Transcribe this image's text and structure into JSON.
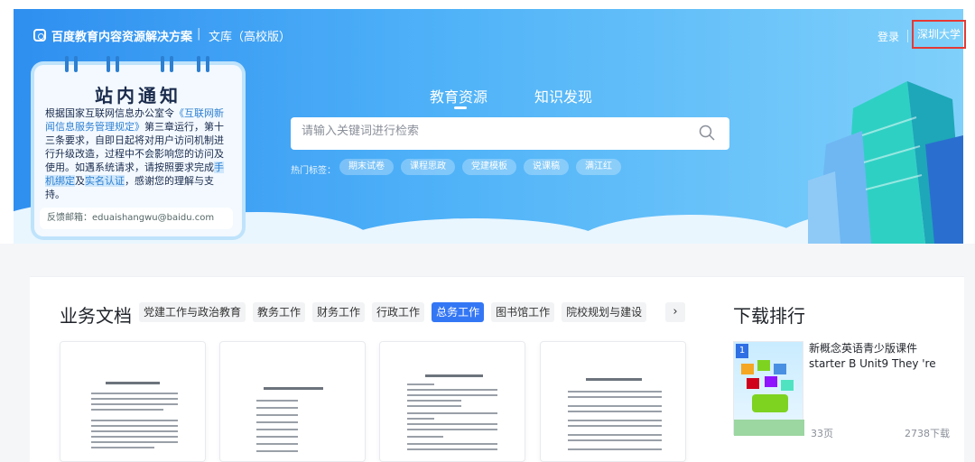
{
  "header": {
    "brand": "百度教育内容资源解决方案",
    "brand_separator": "|",
    "sub_brand": "文库（高校版）",
    "login_label": "登录",
    "org_name": "深圳大学"
  },
  "notice": {
    "title": "站内通知",
    "body_1": "根据国家互联网信息办公室令",
    "body_link_1": "《互联网新闻信息服务管理规定》",
    "body_2": "第三章运行，第十三条要求，自即日起将对用户访问机制进行升级改造，过程中不会影响您的访问及使用。如遇系统请求，请按照要求完成",
    "body_link_2": "手机绑定",
    "body_3": "及",
    "body_link_3": "实名认证",
    "body_4": "，感谢您的理解与支持。",
    "feedback_email": "反馈邮箱：eduaishangwu@baidu.com"
  },
  "nav": {
    "tabs": [
      {
        "label": "教育资源",
        "active": true
      },
      {
        "label": "知识发现",
        "active": false
      }
    ]
  },
  "search": {
    "placeholder": "请输入关键词进行检索",
    "hot_label": "热门标签：",
    "hot_tags": [
      "期末试卷",
      "课程思政",
      "党建模板",
      "说课稿",
      "满江红"
    ]
  },
  "business_docs": {
    "title": "业务文档",
    "categories": [
      {
        "label": "党建工作与政治教育",
        "active": false
      },
      {
        "label": "教务工作",
        "active": false
      },
      {
        "label": "财务工作",
        "active": false
      },
      {
        "label": "行政工作",
        "active": false
      },
      {
        "label": "总务工作",
        "active": true
      },
      {
        "label": "图书馆工作",
        "active": false
      },
      {
        "label": "院校规划与建设",
        "active": false
      }
    ],
    "next_label": "›"
  },
  "download_rank": {
    "title": "下载排行",
    "items": [
      {
        "rank": "1",
        "name": "新概念英语青少版课件starter B Unit9 They 're",
        "pages": "33页",
        "downloads": "2738下载"
      }
    ]
  },
  "colors": {
    "accent": "#3477f5",
    "hero_blue": "#2f8ff0",
    "highlight_border": "#e53935"
  }
}
